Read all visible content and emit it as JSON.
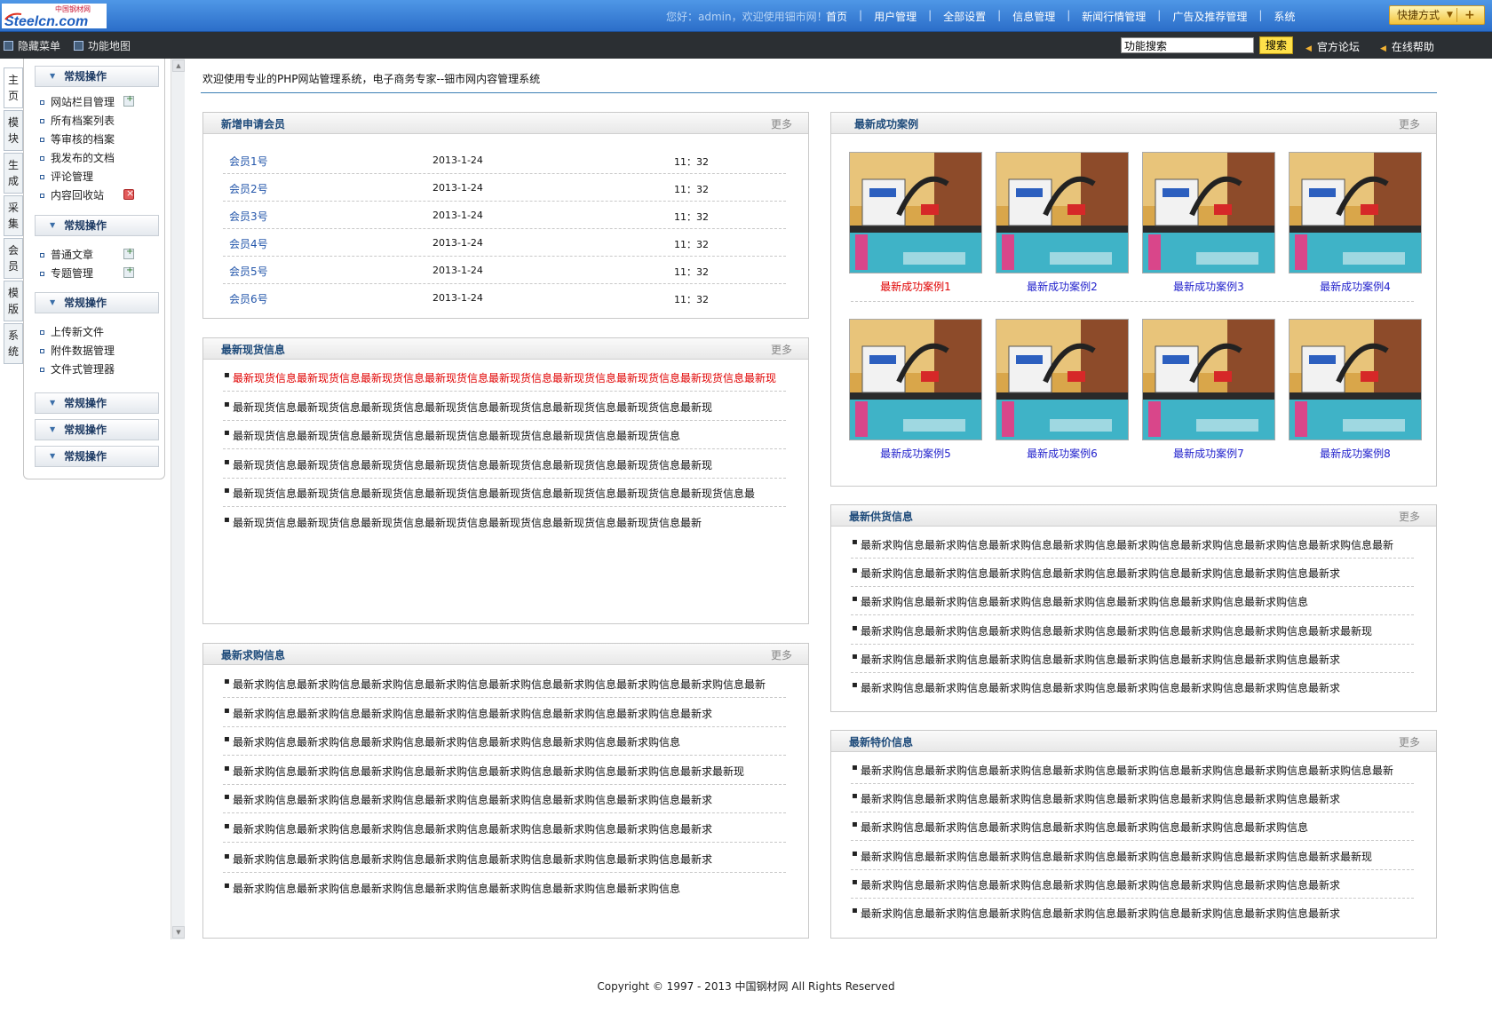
{
  "header": {
    "logo_cn": "中国钢材网",
    "logo_en": "Steelcn.com",
    "greeting": "您好：admin，欢迎使用钿市网！",
    "nav": [
      "首页",
      "用户管理",
      "全部设置",
      "信息管理",
      "新闻行情管理",
      "广告及推荐管理",
      "系统"
    ],
    "quick_label": "快捷方式"
  },
  "subbar": {
    "hide_menu": "隐藏菜单",
    "site_map": "功能地图",
    "search_value": "功能搜索",
    "search_button": "搜索",
    "forum": "官方论坛",
    "help": "在线帮助"
  },
  "side_tabs": [
    "主页",
    "模块",
    "生成",
    "采集",
    "会员",
    "模版",
    "系统"
  ],
  "menu": {
    "group1": {
      "title": "常规操作",
      "items": [
        "网站栏目管理",
        "所有档案列表",
        "等审核的档案",
        "我发布的文档",
        "评论管理",
        "内容回收站"
      ]
    },
    "group2": {
      "title": "常规操作",
      "items": [
        "普通文章",
        "专题管理"
      ]
    },
    "group3": {
      "title": "常规操作",
      "items": [
        "上传新文件",
        "附件数据管理",
        "文件式管理器"
      ]
    },
    "group4": {
      "title": "常规操作"
    },
    "group5": {
      "title": "常规操作"
    },
    "group6": {
      "title": "常规操作"
    }
  },
  "welcome": "欢迎使用专业的PHP网站管理系统，电子商务专家--钿市网内容管理系统",
  "more_label": "更多",
  "members": {
    "title": "新增申请会员",
    "rows": [
      {
        "name": "会员1号",
        "date": "2013-1-24",
        "time": "11：32"
      },
      {
        "name": "会员2号",
        "date": "2013-1-24",
        "time": "11：32"
      },
      {
        "name": "会员3号",
        "date": "2013-1-24",
        "time": "11：32"
      },
      {
        "name": "会员4号",
        "date": "2013-1-24",
        "time": "11：32"
      },
      {
        "name": "会员5号",
        "date": "2013-1-24",
        "time": "11：32"
      },
      {
        "name": "会员6号",
        "date": "2013-1-24",
        "time": "11：32"
      }
    ]
  },
  "spot": {
    "title": "最新现货信息",
    "rows": [
      "最新现货信息最新现货信息最新现货信息最新现货信息最新现货信息最新现货信息最新现货信息最新现货信息最新现",
      "最新现货信息最新现货信息最新现货信息最新现货信息最新现货信息最新现货信息最新现货信息最新现",
      "最新现货信息最新现货信息最新现货信息最新现货信息最新现货信息最新现货信息最新现货信息",
      "最新现货信息最新现货信息最新现货信息最新现货信息最新现货信息最新现货信息最新现货信息最新现",
      "最新现货信息最新现货信息最新现货信息最新现货信息最新现货信息最新现货信息最新现货信息最新现货信息最",
      "最新现货信息最新现货信息最新现货信息最新现货信息最新现货信息最新现货信息最新现货信息最新"
    ]
  },
  "purchase": {
    "title": "最新求购信息",
    "rows": [
      "最新求购信息最新求购信息最新求购信息最新求购信息最新求购信息最新求购信息最新求购信息最新求购信息最新",
      "最新求购信息最新求购信息最新求购信息最新求购信息最新求购信息最新求购信息最新求购信息最新求",
      "最新求购信息最新求购信息最新求购信息最新求购信息最新求购信息最新求购信息最新求购信息",
      "最新求购信息最新求购信息最新求购信息最新求购信息最新求购信息最新求购信息最新求购信息最新求最新现",
      "最新求购信息最新求购信息最新求购信息最新求购信息最新求购信息最新求购信息最新求购信息最新求",
      "最新求购信息最新求购信息最新求购信息最新求购信息最新求购信息最新求购信息最新求购信息最新求",
      "最新求购信息最新求购信息最新求购信息最新求购信息最新求购信息最新求购信息最新求购信息最新求",
      "最新求购信息最新求购信息最新求购信息最新求购信息最新求购信息最新求购信息最新求购信息"
    ]
  },
  "cases": {
    "title": "最新成功案例",
    "items": [
      "最新成功案例1",
      "最新成功案例2",
      "最新成功案例3",
      "最新成功案例4",
      "最新成功案例5",
      "最新成功案例6",
      "最新成功案例7",
      "最新成功案例8"
    ]
  },
  "supply": {
    "title": "最新供货信息",
    "rows": [
      "最新求购信息最新求购信息最新求购信息最新求购信息最新求购信息最新求购信息最新求购信息最新求购信息最新",
      "最新求购信息最新求购信息最新求购信息最新求购信息最新求购信息最新求购信息最新求购信息最新求",
      "最新求购信息最新求购信息最新求购信息最新求购信息最新求购信息最新求购信息最新求购信息",
      "最新求购信息最新求购信息最新求购信息最新求购信息最新求购信息最新求购信息最新求购信息最新求最新现",
      "最新求购信息最新求购信息最新求购信息最新求购信息最新求购信息最新求购信息最新求购信息最新求",
      "最新求购信息最新求购信息最新求购信息最新求购信息最新求购信息最新求购信息最新求购信息最新求"
    ]
  },
  "special": {
    "title": "最新特价信息",
    "rows": [
      "最新求购信息最新求购信息最新求购信息最新求购信息最新求购信息最新求购信息最新求购信息最新求购信息最新",
      "最新求购信息最新求购信息最新求购信息最新求购信息最新求购信息最新求购信息最新求购信息最新求",
      "最新求购信息最新求购信息最新求购信息最新求购信息最新求购信息最新求购信息最新求购信息",
      "最新求购信息最新求购信息最新求购信息最新求购信息最新求购信息最新求购信息最新求购信息最新求最新现",
      "最新求购信息最新求购信息最新求购信息最新求购信息最新求购信息最新求购信息最新求购信息最新求",
      "最新求购信息最新求购信息最新求购信息最新求购信息最新求购信息最新求购信息最新求购信息最新求"
    ]
  },
  "footer": "Copyright © 1997 - 2013  中国钢材网 All Rights Reserved",
  "colors": {
    "header_blue": "#3b82d6",
    "dark_bar": "#2b2f33",
    "title_blue": "#1d4a7a",
    "link_blue": "#2255aa",
    "highlight_red": "#e00000",
    "quick_yellow": "#f2c33c"
  }
}
